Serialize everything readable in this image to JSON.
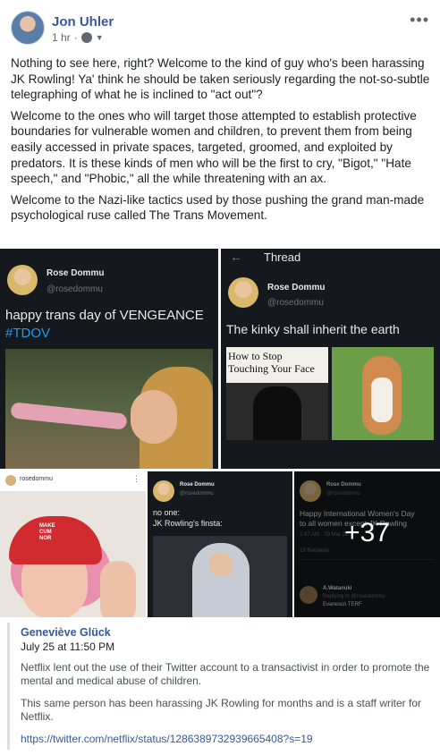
{
  "post": {
    "author": "Jon Uhler",
    "time": "1 hr",
    "more": "•••",
    "paragraphs": [
      "Nothing to see here, right? Welcome to the kind of guy who's been harassing JK Rowling! Ya' think he should be taken seriously regarding the not-so-subtle telegraphing of what he is inclined to \"act out\"?",
      "Welcome to the ones who will target those attempted to establish protective boundaries for vulnerable women and children, to prevent them from being easily accessed in private spaces, targeted, groomed, and exploited by predators. It is these kinds of men who will be the first to cry, \"Bigot,\" \"Hate speech,\" and \"Phobic,\" all the while threatening with an ax.",
      "Welcome to the Nazi-like tactics used by those pushing the grand man-made psychological ruse called The Trans Movement."
    ]
  },
  "photos": {
    "tile1": {
      "name": "Rose Dommu",
      "handle": "@rosedommu",
      "text": "happy trans day of VENGEANCE",
      "hashtag": "#TDOV"
    },
    "tile2": {
      "header": "Thread",
      "name": "Rose Dommu",
      "handle": "@rosedommu",
      "text": "The kinky shall inherit the earth",
      "book_line1": "How to Stop",
      "book_line2": "Touching Your Face"
    },
    "tile3": {
      "username": "rosedommu",
      "cap_line1": "MAKE",
      "cap_line2": "CUM",
      "cap_line3": "NOR"
    },
    "tile4": {
      "name": "Rose Dommu",
      "handle": "@rosedommu",
      "line1": "no one:",
      "line2": "JK Rowling's finsta:"
    },
    "tile5": {
      "name": "Rose Dommu",
      "handle": "@rosedommu",
      "line1": "Happy International Women's Day",
      "line2": "to all women except JK Rowling",
      "timestamp": "2:47 AM · 09 Mar 20",
      "stats": "19 Retweets",
      "reply_name": "A.Watanuki",
      "reply_line": "Replying to @rosedommu",
      "reply_text": "Evanesco TERF",
      "more_count": "+37"
    }
  },
  "shared": {
    "author": "Geneviève Glück",
    "date": "July 25 at 11:50 PM",
    "p1": "Netflix lent out the use of their Twitter account to a transactivist in order to promote the mental and medical abuse of children.",
    "p2": "This same person has been harassing JK Rowling for months and is a staff writer for Netflix.",
    "link": "https://twitter.com/netflix/status/1286389732939665408?s=19"
  }
}
